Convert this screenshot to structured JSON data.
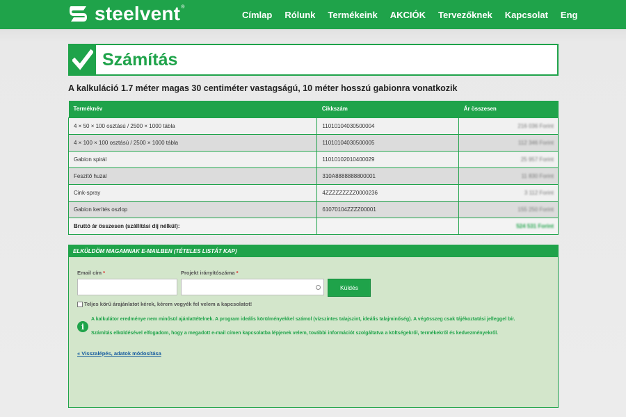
{
  "header": {
    "logo_text": "steelvent",
    "logo_reg": "®",
    "nav": [
      "Címlap",
      "Rólunk",
      "Termékeink",
      "AKCIÓK",
      "Tervezőknek",
      "Kapcsolat",
      "Eng"
    ]
  },
  "page": {
    "title": "Számítás",
    "subtitle": "A kalkuláció 1.7 méter magas 30 centiméter vastagságú, 10 méter hosszú gabionra vonatkozik"
  },
  "table": {
    "columns": [
      "Terméknév",
      "Cikkszám",
      "Ár összesen"
    ],
    "rows": [
      {
        "name": "4 × 50 × 100 osztású / 2500 × 1000 tábla",
        "sku": "11010104030500004",
        "price": "216 036 Forint"
      },
      {
        "name": "4 × 100 × 100 osztású / 2500 × 1000 tábla",
        "sku": "11010104030500005",
        "price": "112 346 Forint"
      },
      {
        "name": "Gabion spirál",
        "sku": "11010102010400029",
        "price": "25 957 Forint"
      },
      {
        "name": "Feszítő huzal",
        "sku": "310A8888888800001",
        "price": "11 830 Forint"
      },
      {
        "name": "Cink-spray",
        "sku": "4ZZZZZZZZZ0000236",
        "price": "3 112 Forint"
      },
      {
        "name": "Gabion kerítés oszlop",
        "sku": "61070104ZZZZ00001",
        "price": "155 250 Forint"
      }
    ],
    "total_label": "Bruttó ár összesen (szállítási díj nélkül):",
    "total_value": "524 531 Forint"
  },
  "email_panel": {
    "heading": "ELKÜLDÖM MAGAMNAK E-MAILBEN (TÉTELES LISTÁT KAP)",
    "email_label": "Email cím",
    "zip_label": "Projekt irányítószáma",
    "required_mark": "*",
    "send_label": "Küldés",
    "checkbox_label": "Teljes körű árajánlatot kérek, kérem vegyék fel velem a kapcsolatot!",
    "info_line1": "A kalkulátor eredménye nem minősül ajánlattételnek. A program ideális körülményekkel számol (vízszintes talajszint, ideális talajminőség). A végösszeg csak tájékoztatási jelleggel bír.",
    "info_line2": "Számítás elküldésével elfogadom, hogy a megadott e-mail címen kapcsolatba lépjenek velem, további információt szolgáltatva a költségekről, termékekről és kedvezményekről.",
    "back_link": "« Visszalépés, adatok módosítása"
  },
  "colors": {
    "brand_green": "#1fa34a",
    "panel_bg": "#d3e6cb",
    "link_blue": "#1a5fa0"
  },
  "icons": [
    "steelvent-logo-icon",
    "checkmark-icon",
    "info-icon"
  ]
}
